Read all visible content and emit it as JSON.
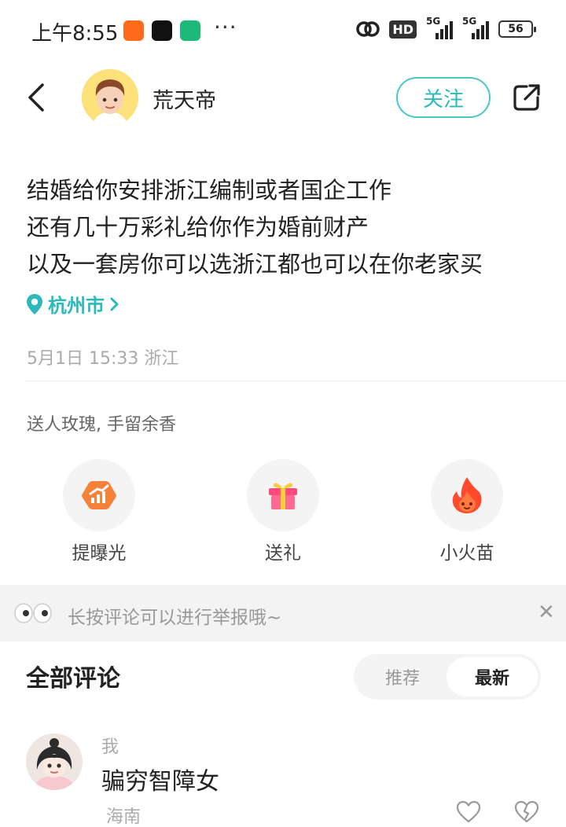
{
  "status_bar": {
    "time": "上午8:55",
    "hd_badge": "HD",
    "signal1_label": "5G",
    "signal2_label": "5G",
    "battery": "56"
  },
  "header": {
    "username": "荒天帝",
    "follow_label": "关注"
  },
  "post": {
    "lines": [
      "结婚给你安排浙江编制或者国企工作",
      "还有几十万彩礼给你作为婚前财产",
      "以及一套房你可以选浙江都也可以在你老家买"
    ],
    "location": "杭州市",
    "meta": "5月1日 15:33 浙江"
  },
  "gift_hint": "送人玫瑰, 手留余香",
  "actions": [
    {
      "label": "提曝光",
      "icon": "boost-icon"
    },
    {
      "label": "送礼",
      "icon": "gift-icon"
    },
    {
      "label": "小火苗",
      "icon": "flame-icon"
    }
  ],
  "notice": {
    "text": "长按评论可以进行举报哦~"
  },
  "comments": {
    "title": "全部评论",
    "sort_options": [
      "推荐",
      "最新"
    ],
    "active_sort": "最新",
    "items": [
      {
        "author": "我",
        "text": "骗穷智障女",
        "location": "海南"
      }
    ]
  },
  "colors": {
    "accent": "#2bb9bc",
    "avatar_bg": "#fde17a",
    "notice_bg": "#f3f3f3"
  }
}
